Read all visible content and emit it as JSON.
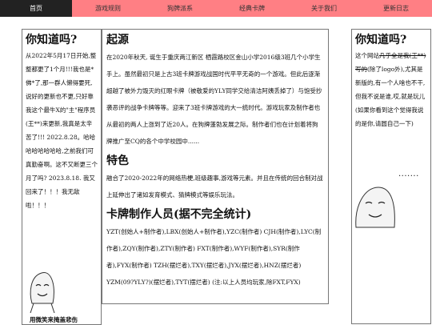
{
  "nav": {
    "home": "首页",
    "items": [
      "游戏规则",
      "狗牌派系",
      "经典卡牌",
      "关于我们",
      "更新日志"
    ]
  },
  "left": {
    "title": "你知道吗?",
    "text": "从2022年5月17日开始,整整都更了1个月!!!我也是*佛*了,那一群人懒得要死,说好的更新也不更,只好靠我这个最牛X的\"主\"程序员(王**)来更新,我真是太辛苦了!!! 2022.8.28。哈哈哈哈哈哈哈哈,之前我们可真勤奋啊。这不又断更三个月了吗? 2023.8.18. 我又回来了！！！我无敌啦！！！",
    "caption": "用微笑来掩盖悲伤"
  },
  "mid": {
    "origin_title": "起源",
    "origin_text": "在2020年秋天, 诞生于重庆两江新区 栖霞路校区金山小学2016级3班几个小学生手上。虽然最初只是上古3班卡牌游戏战国时代平平无奇的一个游戏。但此后逐渐超越了被外力毁灭的红眼卡牌（被敬爱的YLY同学交给清洁阿姨丢掉了）与饱受抄袭恶评的战争卡牌等等。迎来了3班卡牌游戏的大一统时代。游戏玩家及制作者也从最初的两人上涨到了近20人。在狗牌蓬勃发展之际。制作者们也在计划着将狗牌推广至CQ的各个中学校园中......",
    "feature_title": "特色",
    "feature_text": "融合了2020-2022年的网络热梗,班级趣事,游戏等元素。并且在传统的回合制对战上延伸出了诸如发育模式、猜牌模式等娱乐玩法。",
    "staff_title": "卡牌制作人员(据不完全统计)",
    "staff_text": "YZT(创始人+制作者),LBX(创始人+制作者),YZC(制作者) CJH(制作者),LYC(制作者),ZQY(制作者),ZTY(制作者) FXT(制作者),WYF(制作者),SYR(制作者),FYX(制作者) TZH(摆烂者),TXY(摆烂者),JYX(摆烂者),HNZ(摆烂者) YZM(09?YLY?)(摆烂者),TYT(摆烂者) (注:以上人员均玩家,除FXT,FYX)"
  },
  "right": {
    "title": "你知道吗?",
    "text_pre": "这个网站",
    "text_strike": "几乎全是我(王**)写的",
    "text_post": "(除了logo外),尤其是新版的,有一个人啥也不干,但我不说是谁,哎,就是玩儿(如果你看到这个觉得我说的是你,请圆自己一下)",
    "dots": "......."
  }
}
